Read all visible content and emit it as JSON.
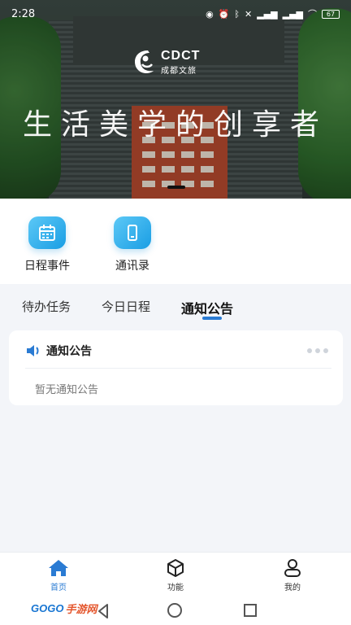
{
  "status_bar": {
    "time": "2:28",
    "battery": "67"
  },
  "banner": {
    "logo_en": "CDCT",
    "logo_cn": "成都文旅",
    "slogan": "生活美学的创享者"
  },
  "quick_actions": [
    {
      "label": "日程事件",
      "icon": "calendar-icon"
    },
    {
      "label": "通讯录",
      "icon": "phone-icon"
    }
  ],
  "tabs": [
    {
      "label": "待办任务",
      "active": false
    },
    {
      "label": "今日日程",
      "active": false
    },
    {
      "label": "通知公告",
      "active": true
    }
  ],
  "notice_card": {
    "title": "通知公告",
    "empty_text": "暂无通知公告"
  },
  "bottom_nav": [
    {
      "label": "首页",
      "icon": "home-icon",
      "active": true
    },
    {
      "label": "功能",
      "icon": "cube-icon",
      "active": false
    },
    {
      "label": "我的",
      "icon": "user-icon",
      "active": false
    }
  ],
  "watermark": {
    "brand": "GOGO",
    "suffix": "手游网"
  },
  "colors": {
    "accent": "#2a7bd3",
    "icon_gradient_start": "#5cc8f6",
    "icon_gradient_end": "#1a9ee4",
    "background": "#f3f5f9"
  }
}
